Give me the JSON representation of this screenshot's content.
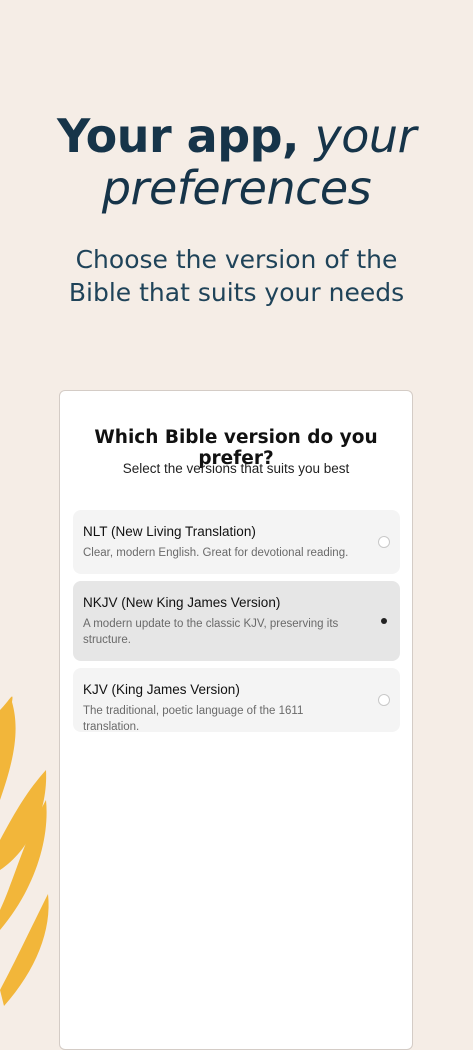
{
  "hero": {
    "title_plain": "Your app, ",
    "title_italic_1": "your",
    "title_italic_2": "preferences",
    "subtitle": "Choose the version of the Bible that suits your needs"
  },
  "card": {
    "title": "Which Bible version do you prefer?",
    "subtitle": "Select the versions that suits you best"
  },
  "options": [
    {
      "name": "NLT (New Living Translation)",
      "description": "Clear, modern English. Great for devotional reading.",
      "selected": false
    },
    {
      "name": "NKJV (New King James Version)",
      "description": "A modern update to the classic KJV, preserving its structure.",
      "selected": true
    },
    {
      "name": "KJV (King James Version)",
      "description": "The traditional, poetic language of the 1611 translation.",
      "selected": false
    }
  ],
  "colors": {
    "background": "#f5ede6",
    "heading": "#163449",
    "wheat": "#f2b63a",
    "selected_option": "#e6e6e6"
  }
}
